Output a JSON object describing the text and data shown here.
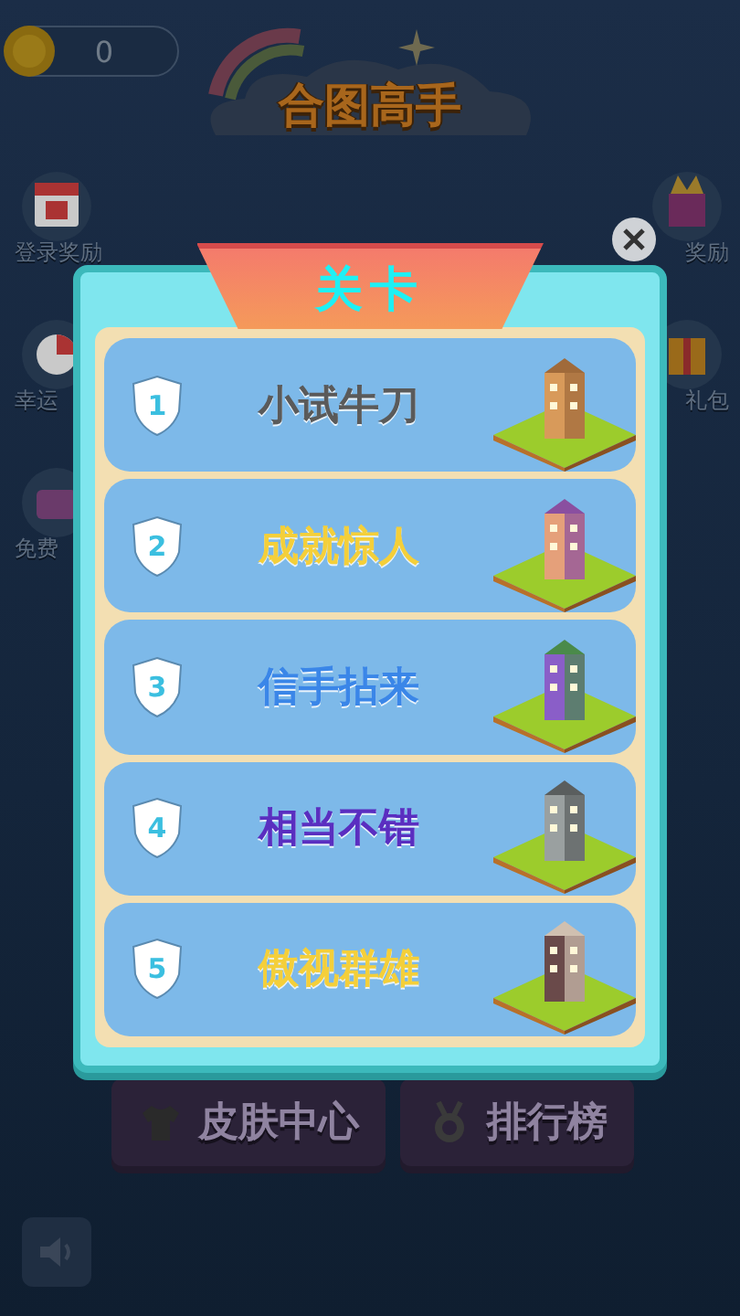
{
  "hud": {
    "coins": "0"
  },
  "title": "合图高手",
  "side_left": [
    {
      "label": "登录奖励",
      "kind": "calendar"
    },
    {
      "label": "幸运",
      "kind": "candy"
    },
    {
      "label": "免费",
      "kind": "cake"
    }
  ],
  "side_right": [
    {
      "label": "奖励",
      "kind": "gift"
    },
    {
      "label": "礼包",
      "kind": "box"
    }
  ],
  "modal": {
    "title": "关卡",
    "levels": [
      {
        "number": "1",
        "name": "小试牛刀",
        "color": "#5a5a5a"
      },
      {
        "number": "2",
        "name": "成就惊人",
        "color": "#f4cf3a"
      },
      {
        "number": "3",
        "name": "信手拈来",
        "color": "#3a86e8"
      },
      {
        "number": "4",
        "name": "相当不错",
        "color": "#5a2ec0"
      },
      {
        "number": "5",
        "name": "傲视群雄",
        "color": "#f4cf3a"
      }
    ]
  },
  "bottom_buttons": [
    {
      "label": "皮肤中心",
      "kind": "shirt"
    },
    {
      "label": "排行榜",
      "kind": "medal"
    }
  ]
}
